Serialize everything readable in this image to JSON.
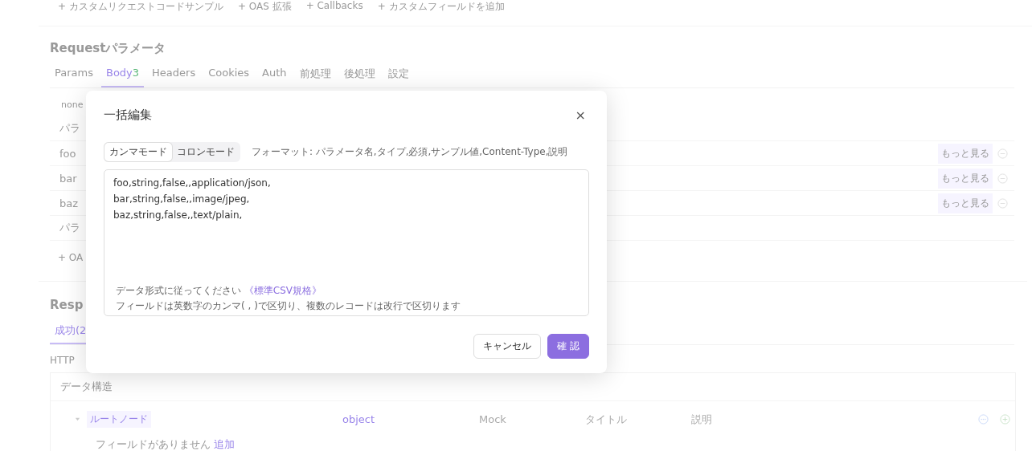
{
  "top_actions": [
    "+ カスタムリクエストコードサンプル",
    "+ OAS 拡張",
    "+ Callbacks",
    "+ カスタムフィールドを追加"
  ],
  "request": {
    "title": "Requestパラメータ",
    "tabs": [
      {
        "label": "Params",
        "selected": false
      },
      {
        "label": "Body",
        "count": "3",
        "selected": true
      },
      {
        "label": "Headers",
        "selected": false
      },
      {
        "label": "Cookies",
        "selected": false
      },
      {
        "label": "Auth",
        "selected": false
      },
      {
        "label": "前処理",
        "selected": false
      },
      {
        "label": "後処理",
        "selected": false
      },
      {
        "label": "設定",
        "selected": false
      }
    ],
    "body_type": "none",
    "header_label": "パラ",
    "rows": [
      {
        "name": "foo",
        "more": "もっと見る"
      },
      {
        "name": "bar",
        "more": "もっと見る"
      },
      {
        "name": "baz",
        "more": "もっと見る"
      }
    ],
    "footer_label": "パラ",
    "add_link": "+ OA"
  },
  "response": {
    "title": "Resp",
    "tabs": [
      {
        "label": "成功(2",
        "selected": true
      }
    ],
    "status_label": "HTTP",
    "structure": {
      "title": "データ構造",
      "root": {
        "expanded": true,
        "name": "ルートノード",
        "type": "object",
        "mock_placeholder": "Mock",
        "title_placeholder": "タイトル",
        "desc_placeholder": "説明"
      },
      "empty": "フィールドがありません",
      "add": "追加"
    }
  },
  "modal": {
    "title": "一括編集",
    "close": "×",
    "modes": [
      {
        "label": "カンマモード",
        "selected": true
      },
      {
        "label": "コロンモード",
        "selected": false
      }
    ],
    "format": "フォーマット: パラメータ名,タイプ,必須,サンプル値,Content-Type,説明",
    "value": "foo,string,false,,application/json,\nbar,string,false,,image/jpeg,\nbaz,string,false,,text/plain,",
    "hint": "データ形式に従ってください",
    "hint_link": "《標準CSV規格》",
    "hint2": "フィールドは英数字のカンマ( , )で区切り、複数のレコードは改行で区切ります",
    "buttons": [
      {
        "label": "キャンセル",
        "kind": "default"
      },
      {
        "label": "確 認",
        "kind": "primary"
      }
    ]
  }
}
